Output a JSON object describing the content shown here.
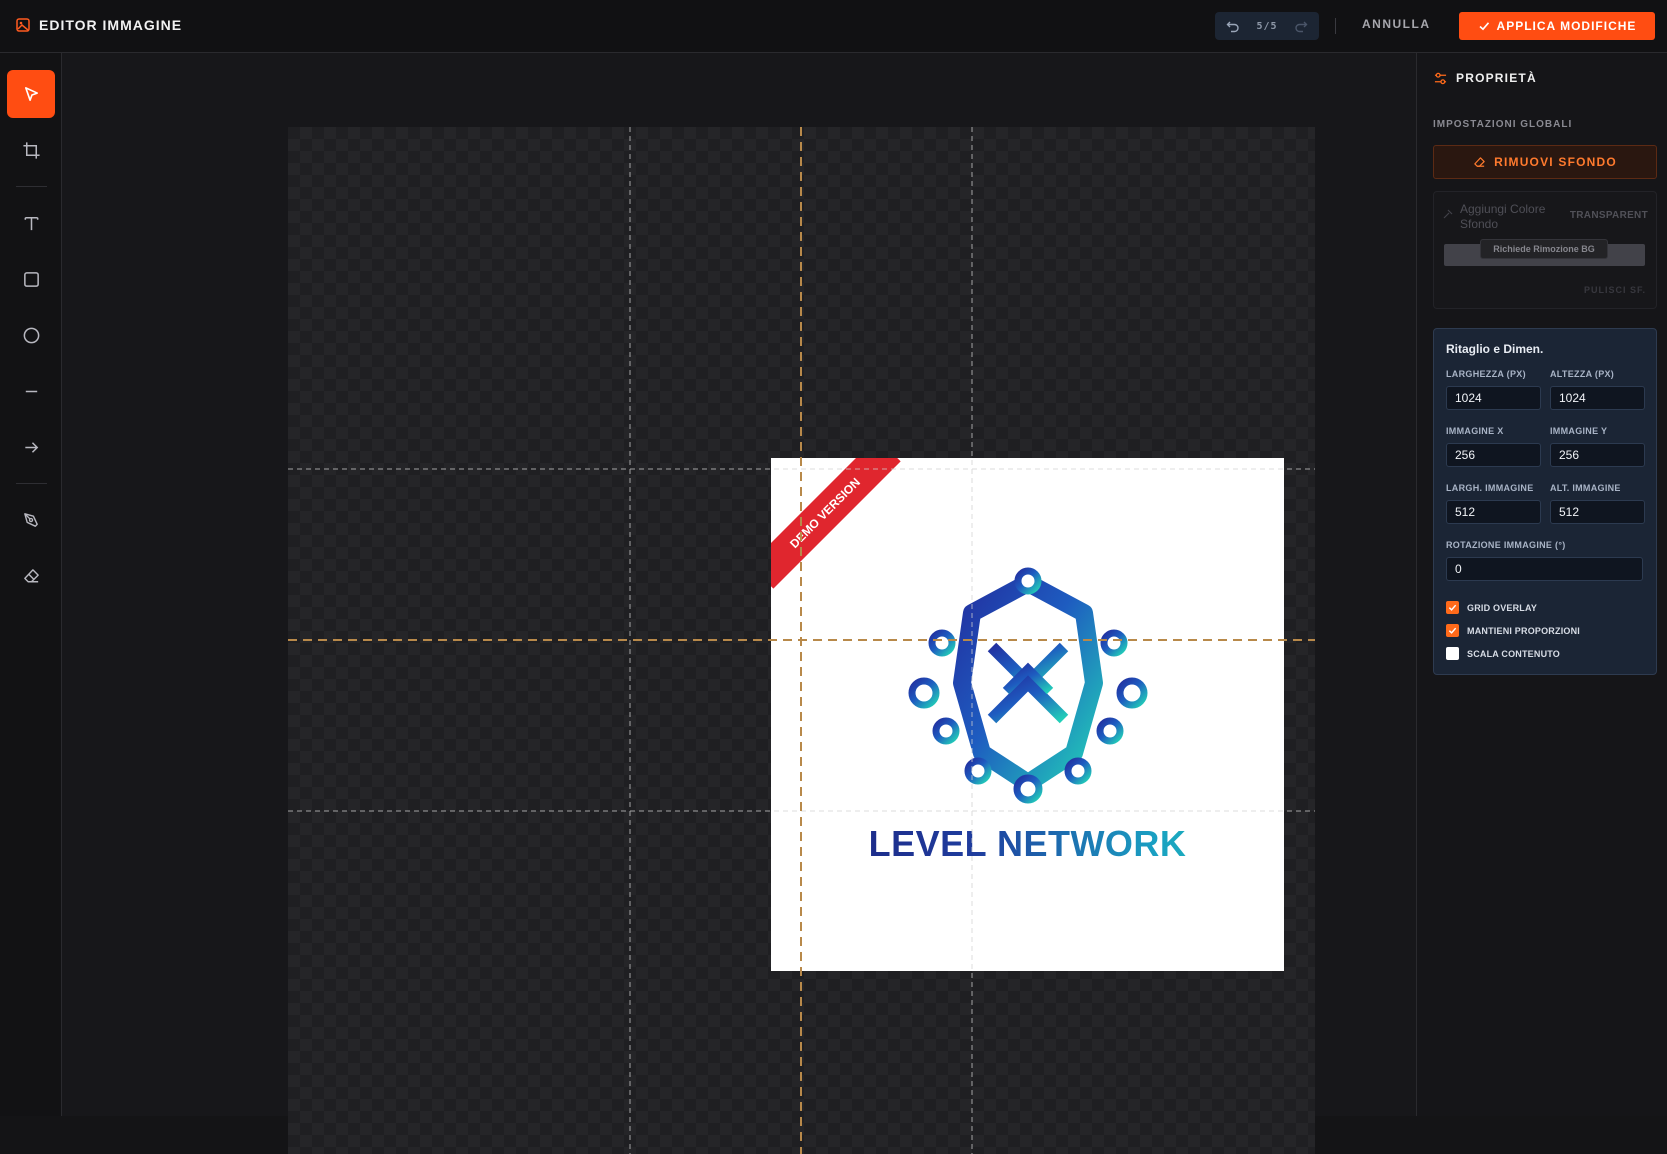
{
  "header": {
    "title": "EDITOR IMMAGINE",
    "history_count": "5/5",
    "cancel_label": "ANNULLA",
    "apply_label": "APPLICA MODIFICHE"
  },
  "toolbar": {
    "tools": [
      {
        "name": "select-tool",
        "icon": "cursor-icon",
        "active": true
      },
      {
        "name": "crop-tool",
        "icon": "crop-icon"
      },
      {
        "name": "text-tool",
        "icon": "text-icon"
      },
      {
        "name": "rectangle-tool",
        "icon": "square-icon"
      },
      {
        "name": "ellipse-tool",
        "icon": "circle-icon"
      },
      {
        "name": "line-tool",
        "icon": "line-icon"
      },
      {
        "name": "arrow-tool",
        "icon": "arrow-right-icon"
      },
      {
        "name": "pen-tool",
        "icon": "pen-icon"
      },
      {
        "name": "eraser-tool",
        "icon": "eraser-icon"
      }
    ]
  },
  "canvas": {
    "ribbon_text": "DEMO VERSION",
    "logo_text": "LEVEL NETWORK",
    "grid_overlay": true
  },
  "panel": {
    "title": "PROPRIETÀ",
    "global_section": "IMPOSTAZIONI GLOBALI",
    "remove_bg_label": "RIMUOVI SFONDO",
    "bg_color_label": "Aggiungi Colore Sfondo",
    "bg_color_value": "TRANSPARENT",
    "bg_tooltip": "Richiede Rimozione BG",
    "clear_bg_label": "PULISCI SF.",
    "crop": {
      "title": "Ritaglio e Dimen.",
      "width_label": "LARGHEZZA (PX)",
      "width_value": "1024",
      "height_label": "ALTEZZA (PX)",
      "height_value": "1024",
      "img_x_label": "IMMAGINE X",
      "img_x_value": "256",
      "img_y_label": "IMMAGINE Y",
      "img_y_value": "256",
      "img_w_label": "LARGH. IMMAGINE",
      "img_w_value": "512",
      "img_h_label": "ALT. IMMAGINE",
      "img_h_value": "512",
      "rotation_label": "ROTAZIONE IMMAGINE (°)",
      "rotation_value": "0",
      "options": [
        {
          "label": "GRID OVERLAY",
          "checked": true
        },
        {
          "label": "MANTIENI PROPORZIONI",
          "checked": true
        },
        {
          "label": "SCALA CONTENUTO",
          "checked": false
        }
      ]
    }
  },
  "colors": {
    "accent": "#ff4d12",
    "panel_bg": "#151518",
    "crop_panel_bg": "#1b2535",
    "ribbon": "#e0262e"
  }
}
